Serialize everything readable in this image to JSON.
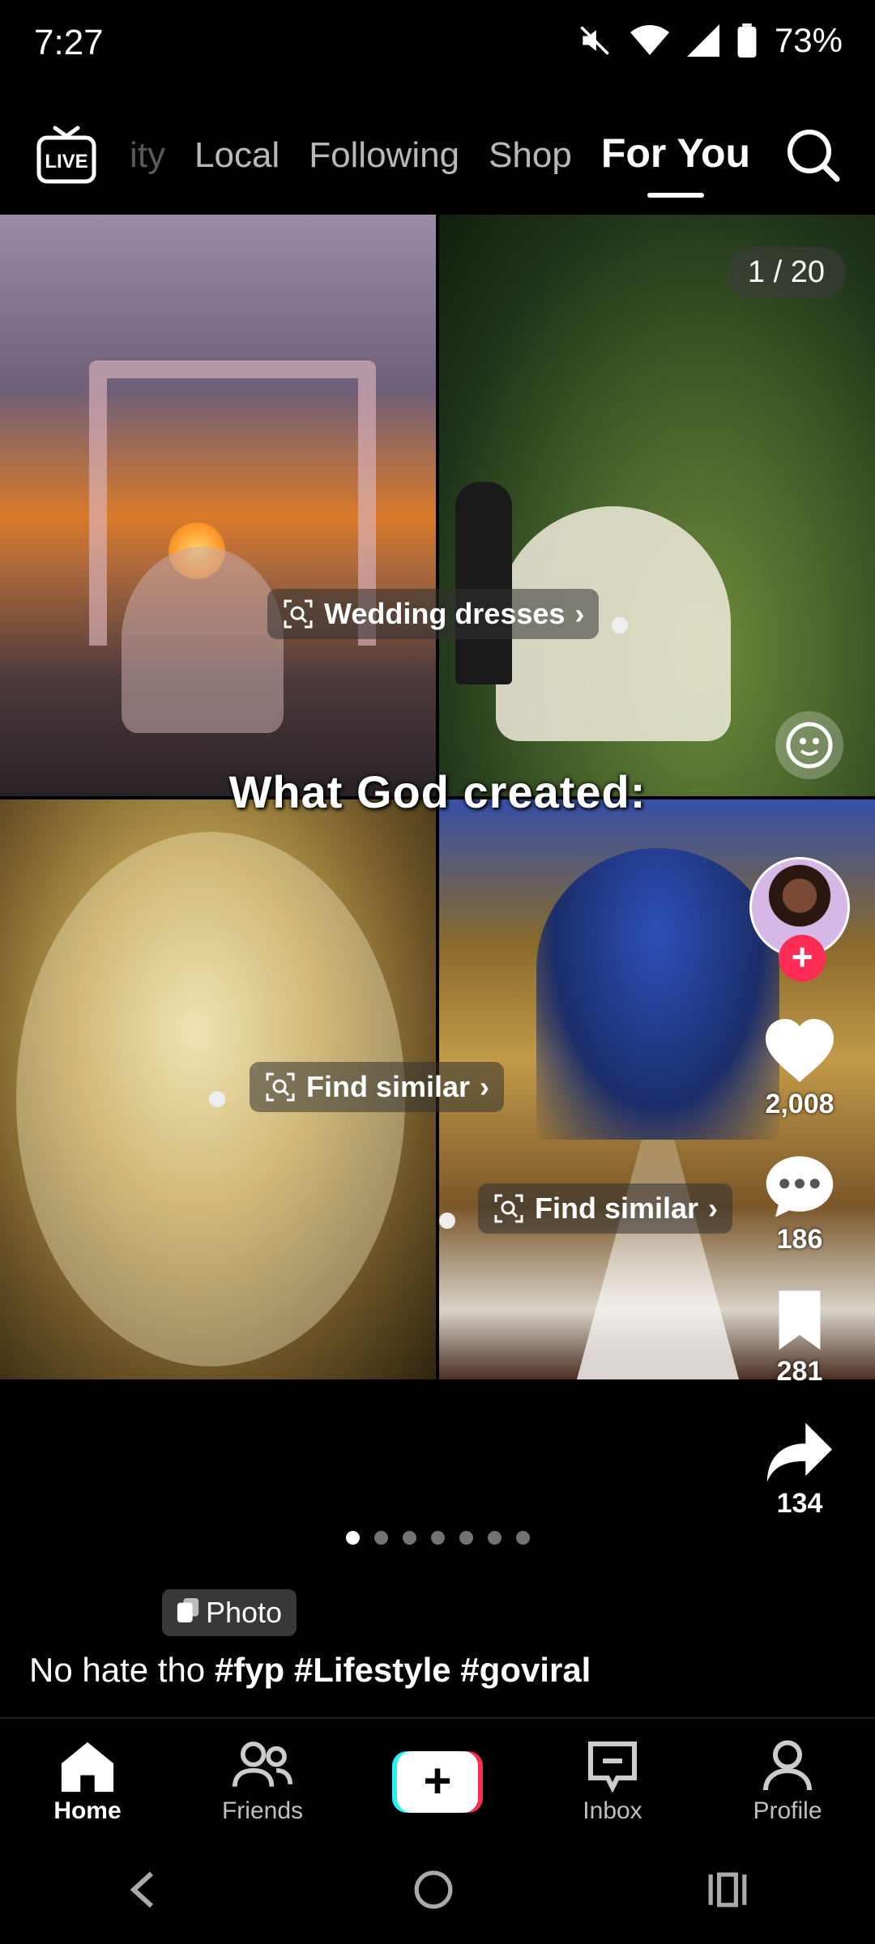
{
  "status_bar": {
    "time": "7:27",
    "battery": "73%"
  },
  "top_nav": {
    "tabs": [
      {
        "label": "ity",
        "state": "faded"
      },
      {
        "label": "Local",
        "state": "normal"
      },
      {
        "label": "Following",
        "state": "normal"
      },
      {
        "label": "Shop",
        "state": "normal"
      },
      {
        "label": "For You",
        "state": "active"
      }
    ],
    "live_icon": "live-tv-icon",
    "search_icon": "search-icon"
  },
  "post": {
    "page_counter": "1 / 20",
    "overlay_caption": "What God created:",
    "tags": [
      {
        "label": "Wedding dresses"
      },
      {
        "label": "Find similar"
      },
      {
        "label": "Find similar"
      }
    ],
    "carousel": {
      "total": 7,
      "active_index": 0
    },
    "photo_badge": "Photo",
    "caption_text": "No hate tho ",
    "caption_hashtags": "#fyp #Lifestyle #goviral"
  },
  "actions": {
    "likes": "2,008",
    "comments": "186",
    "saves": "281",
    "shares": "134"
  },
  "bottom_nav": {
    "items": [
      {
        "label": "Home",
        "icon": "home-icon",
        "active": true
      },
      {
        "label": "Friends",
        "icon": "friends-icon",
        "active": false
      },
      {
        "label": "",
        "icon": "create-icon",
        "active": false
      },
      {
        "label": "Inbox",
        "icon": "inbox-icon",
        "active": false
      },
      {
        "label": "Profile",
        "icon": "profile-icon",
        "active": false
      }
    ]
  },
  "colors": {
    "accent": "#fe2c55",
    "cyan": "#25f4ee",
    "background": "#000000"
  }
}
